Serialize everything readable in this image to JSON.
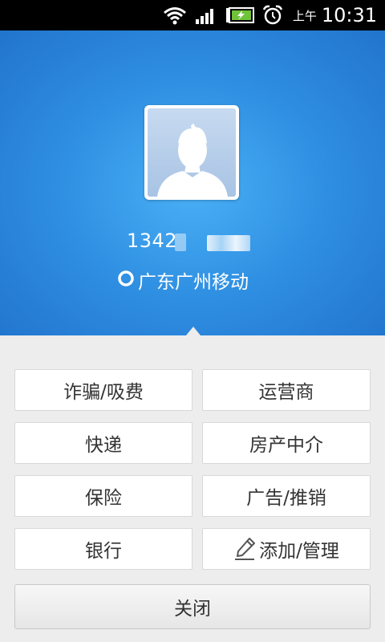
{
  "status_bar": {
    "ampm": "上午",
    "time": "10:31",
    "icons": [
      "wifi-icon",
      "signal-icon",
      "battery-charging-icon",
      "alarm-icon"
    ]
  },
  "caller": {
    "number_visible": "1342",
    "location": "广东广州移动",
    "avatar_icon": "default-avatar-icon"
  },
  "tags": [
    "诈骗/吸费",
    "运营商",
    "快递",
    "房产中介",
    "保险",
    "广告/推销",
    "银行",
    "添加/管理"
  ],
  "close_label": "关闭",
  "colors": {
    "header_blue": "#2f8fe2",
    "panel_bg": "#ededed",
    "button_bg": "#ffffff",
    "text": "#333333"
  }
}
